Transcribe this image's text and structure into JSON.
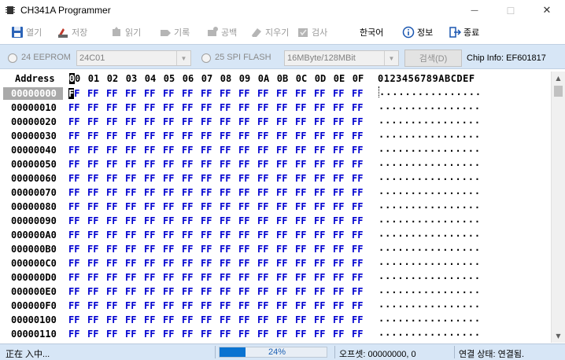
{
  "window": {
    "title": "CH341A Programmer",
    "minimize": "—",
    "maximize": "☐",
    "close": "✕"
  },
  "toolbar": {
    "items": [
      {
        "label": "열기",
        "icon": "save-disk-icon",
        "enabled": false
      },
      {
        "label": "저장",
        "icon": "save-icon",
        "enabled": false
      },
      {
        "label": "읽기",
        "icon": "read-chip-icon",
        "enabled": false
      },
      {
        "label": "기록",
        "icon": "write-chip-icon",
        "enabled": false
      },
      {
        "label": "공백",
        "icon": "blank-check-icon",
        "enabled": false
      },
      {
        "label": "지우기",
        "icon": "erase-icon",
        "enabled": false
      },
      {
        "label": "검사",
        "icon": "verify-icon",
        "enabled": false
      },
      {
        "label": "한국어",
        "icon": "",
        "enabled": true
      },
      {
        "label": "정보",
        "icon": "info-icon",
        "enabled": true
      },
      {
        "label": "종료",
        "icon": "exit-icon",
        "enabled": true
      }
    ]
  },
  "options": {
    "eeprom_label": "24 EEPROM",
    "eeprom_model": "24C01",
    "spi_label": "25 SPI FLASH",
    "spi_model": "16MByte/128MBit",
    "search_button": "검색(D)",
    "chip_info": "Chip Info: EF601817"
  },
  "hex": {
    "address_header": "Address",
    "columns": [
      "00",
      "01",
      "02",
      "03",
      "04",
      "05",
      "06",
      "07",
      "08",
      "09",
      "0A",
      "0B",
      "0C",
      "0D",
      "0E",
      "0F"
    ],
    "ascii_header": "0123456789ABCDEF",
    "rows": [
      {
        "addr": "00000000",
        "bytes": [
          "FF",
          "FF",
          "FF",
          "FF",
          "FF",
          "FF",
          "FF",
          "FF",
          "FF",
          "FF",
          "FF",
          "FF",
          "FF",
          "FF",
          "FF",
          "FF"
        ],
        "ascii": "................"
      },
      {
        "addr": "00000010",
        "bytes": [
          "FF",
          "FF",
          "FF",
          "FF",
          "FF",
          "FF",
          "FF",
          "FF",
          "FF",
          "FF",
          "FF",
          "FF",
          "FF",
          "FF",
          "FF",
          "FF"
        ],
        "ascii": "................"
      },
      {
        "addr": "00000020",
        "bytes": [
          "FF",
          "FF",
          "FF",
          "FF",
          "FF",
          "FF",
          "FF",
          "FF",
          "FF",
          "FF",
          "FF",
          "FF",
          "FF",
          "FF",
          "FF",
          "FF"
        ],
        "ascii": "................"
      },
      {
        "addr": "00000030",
        "bytes": [
          "FF",
          "FF",
          "FF",
          "FF",
          "FF",
          "FF",
          "FF",
          "FF",
          "FF",
          "FF",
          "FF",
          "FF",
          "FF",
          "FF",
          "FF",
          "FF"
        ],
        "ascii": "................"
      },
      {
        "addr": "00000040",
        "bytes": [
          "FF",
          "FF",
          "FF",
          "FF",
          "FF",
          "FF",
          "FF",
          "FF",
          "FF",
          "FF",
          "FF",
          "FF",
          "FF",
          "FF",
          "FF",
          "FF"
        ],
        "ascii": "................"
      },
      {
        "addr": "00000050",
        "bytes": [
          "FF",
          "FF",
          "FF",
          "FF",
          "FF",
          "FF",
          "FF",
          "FF",
          "FF",
          "FF",
          "FF",
          "FF",
          "FF",
          "FF",
          "FF",
          "FF"
        ],
        "ascii": "................"
      },
      {
        "addr": "00000060",
        "bytes": [
          "FF",
          "FF",
          "FF",
          "FF",
          "FF",
          "FF",
          "FF",
          "FF",
          "FF",
          "FF",
          "FF",
          "FF",
          "FF",
          "FF",
          "FF",
          "FF"
        ],
        "ascii": "................"
      },
      {
        "addr": "00000070",
        "bytes": [
          "FF",
          "FF",
          "FF",
          "FF",
          "FF",
          "FF",
          "FF",
          "FF",
          "FF",
          "FF",
          "FF",
          "FF",
          "FF",
          "FF",
          "FF",
          "FF"
        ],
        "ascii": "................"
      },
      {
        "addr": "00000080",
        "bytes": [
          "FF",
          "FF",
          "FF",
          "FF",
          "FF",
          "FF",
          "FF",
          "FF",
          "FF",
          "FF",
          "FF",
          "FF",
          "FF",
          "FF",
          "FF",
          "FF"
        ],
        "ascii": "................"
      },
      {
        "addr": "00000090",
        "bytes": [
          "FF",
          "FF",
          "FF",
          "FF",
          "FF",
          "FF",
          "FF",
          "FF",
          "FF",
          "FF",
          "FF",
          "FF",
          "FF",
          "FF",
          "FF",
          "FF"
        ],
        "ascii": "................"
      },
      {
        "addr": "000000A0",
        "bytes": [
          "FF",
          "FF",
          "FF",
          "FF",
          "FF",
          "FF",
          "FF",
          "FF",
          "FF",
          "FF",
          "FF",
          "FF",
          "FF",
          "FF",
          "FF",
          "FF"
        ],
        "ascii": "................"
      },
      {
        "addr": "000000B0",
        "bytes": [
          "FF",
          "FF",
          "FF",
          "FF",
          "FF",
          "FF",
          "FF",
          "FF",
          "FF",
          "FF",
          "FF",
          "FF",
          "FF",
          "FF",
          "FF",
          "FF"
        ],
        "ascii": "................"
      },
      {
        "addr": "000000C0",
        "bytes": [
          "FF",
          "FF",
          "FF",
          "FF",
          "FF",
          "FF",
          "FF",
          "FF",
          "FF",
          "FF",
          "FF",
          "FF",
          "FF",
          "FF",
          "FF",
          "FF"
        ],
        "ascii": "................"
      },
      {
        "addr": "000000D0",
        "bytes": [
          "FF",
          "FF",
          "FF",
          "FF",
          "FF",
          "FF",
          "FF",
          "FF",
          "FF",
          "FF",
          "FF",
          "FF",
          "FF",
          "FF",
          "FF",
          "FF"
        ],
        "ascii": "................"
      },
      {
        "addr": "000000E0",
        "bytes": [
          "FF",
          "FF",
          "FF",
          "FF",
          "FF",
          "FF",
          "FF",
          "FF",
          "FF",
          "FF",
          "FF",
          "FF",
          "FF",
          "FF",
          "FF",
          "FF"
        ],
        "ascii": "................"
      },
      {
        "addr": "000000F0",
        "bytes": [
          "FF",
          "FF",
          "FF",
          "FF",
          "FF",
          "FF",
          "FF",
          "FF",
          "FF",
          "FF",
          "FF",
          "FF",
          "FF",
          "FF",
          "FF",
          "FF"
        ],
        "ascii": "................"
      },
      {
        "addr": "00000100",
        "bytes": [
          "FF",
          "FF",
          "FF",
          "FF",
          "FF",
          "FF",
          "FF",
          "FF",
          "FF",
          "FF",
          "FF",
          "FF",
          "FF",
          "FF",
          "FF",
          "FF"
        ],
        "ascii": "................"
      },
      {
        "addr": "00000110",
        "bytes": [
          "FF",
          "FF",
          "FF",
          "FF",
          "FF",
          "FF",
          "FF",
          "FF",
          "FF",
          "FF",
          "FF",
          "FF",
          "FF",
          "FF",
          "FF",
          "FF"
        ],
        "ascii": "................"
      }
    ]
  },
  "status": {
    "message": "正在 入中...",
    "progress_fraction": 0.24,
    "progress_text": "24%",
    "offset": "오프셋: 00000000, 0",
    "connection": "연결 상태: 연결됨."
  },
  "colors": {
    "byte_blue": "#0000d0",
    "status_bg": "#d7e6f6",
    "progress_blue": "#0a73d1"
  }
}
